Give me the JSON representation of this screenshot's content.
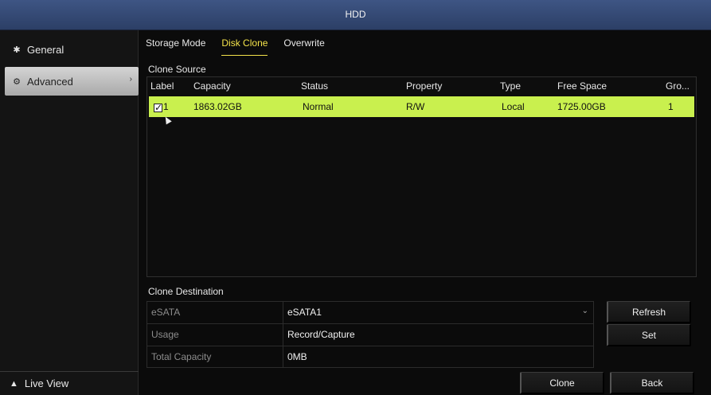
{
  "window": {
    "title": "HDD"
  },
  "sidebar": {
    "items": [
      {
        "label": "General",
        "icon": "gear-icon"
      },
      {
        "label": "Advanced",
        "icon": "advanced-gear-icon",
        "selected": true
      }
    ],
    "live_view": {
      "label": "Live View",
      "icon": "home-icon"
    }
  },
  "tabs": [
    {
      "label": "Storage Mode"
    },
    {
      "label": "Disk Clone",
      "active": true
    },
    {
      "label": "Overwrite"
    }
  ],
  "clone_source": {
    "title": "Clone Source",
    "columns": [
      "Label",
      "Capacity",
      "Status",
      "Property",
      "Type",
      "Free Space",
      "Gro..."
    ],
    "rows": [
      {
        "label": "1",
        "checked": true,
        "capacity": "1863.02GB",
        "status": "Normal",
        "property": "R/W",
        "type": "Local",
        "free_space": "1725.00GB",
        "group": "1"
      }
    ],
    "highlight_color": "#c9f04e"
  },
  "clone_destination": {
    "title": "Clone Destination",
    "fields": [
      {
        "label": "eSATA",
        "value": "eSATA1",
        "dropdown": true
      },
      {
        "label": "Usage",
        "value": "Record/Capture"
      },
      {
        "label": "Total Capacity",
        "value": "0MB"
      }
    ]
  },
  "buttons": {
    "refresh": "Refresh",
    "set": "Set",
    "clone": "Clone",
    "back": "Back"
  },
  "colors": {
    "accent_tab": "#f3e24a",
    "titlebar": "#34497a"
  }
}
